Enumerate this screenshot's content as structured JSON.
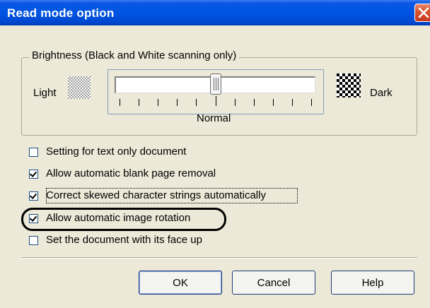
{
  "window": {
    "title": "Read mode option"
  },
  "brightness": {
    "group_label": "Brightness (Black and White scanning only)",
    "light_label": "Light",
    "dark_label": "Dark",
    "normal_label": "Normal",
    "slider_value": 0.5,
    "tick_count": 11
  },
  "options": [
    {
      "label": "Setting for text only document",
      "checked": false
    },
    {
      "label": "Allow automatic blank page removal",
      "checked": true
    },
    {
      "label": "Correct skewed character strings automatically",
      "checked": true
    },
    {
      "label": "Allow automatic image rotation",
      "checked": true
    },
    {
      "label": "Set the document with its face up",
      "checked": false
    }
  ],
  "buttons": {
    "ok": "OK",
    "cancel": "Cancel",
    "help": "Help"
  },
  "colors": {
    "titlebar": "#0054e3",
    "dialog_bg": "#ece9d8",
    "close": "#d9532f",
    "highlight_ring": "#000000"
  }
}
